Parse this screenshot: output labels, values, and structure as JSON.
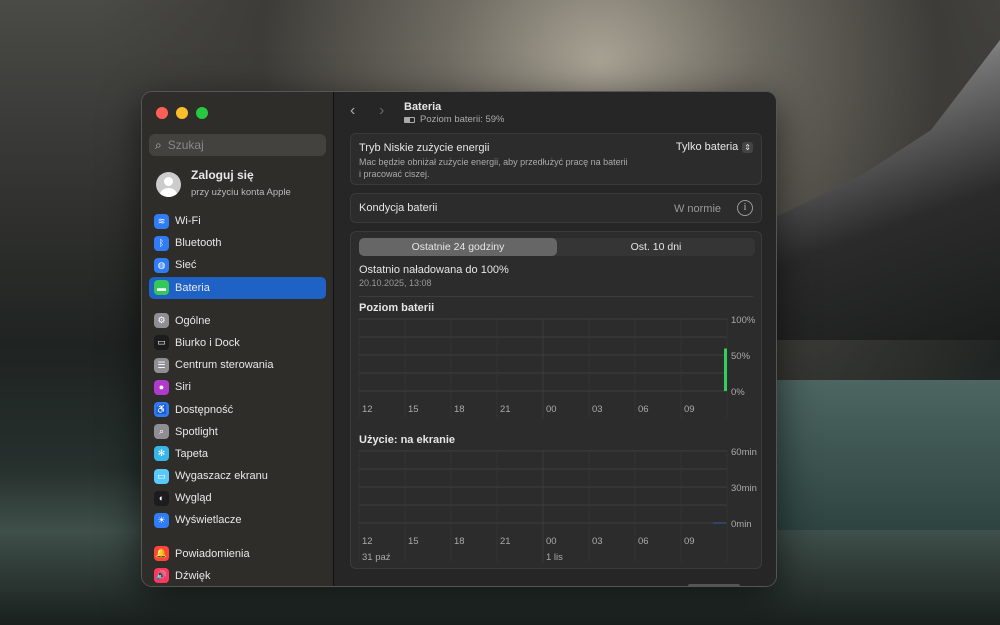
{
  "sidebar": {
    "search_placeholder": "Szukaj",
    "account": {
      "name": "Zaloguj się",
      "sub": "przy użyciu konta Apple"
    },
    "groups": [
      [
        {
          "label": "Wi-Fi",
          "icon": "wifi-icon",
          "color": "#2f7cf6",
          "glyph": "≋"
        },
        {
          "label": "Bluetooth",
          "icon": "bluetooth-icon",
          "color": "#2f7cf6",
          "glyph": "ᛒ"
        },
        {
          "label": "Sieć",
          "icon": "globe-icon",
          "color": "#2f7cf6",
          "glyph": "◍"
        },
        {
          "label": "Bateria",
          "icon": "battery-icon",
          "color": "#34c759",
          "glyph": "▬",
          "selected": true
        }
      ],
      [
        {
          "label": "Ogólne",
          "icon": "gear-icon",
          "color": "#8e8e93",
          "glyph": "⚙"
        },
        {
          "label": "Biurko i Dock",
          "icon": "dock-icon",
          "color": "#1c1c1e",
          "glyph": "▭"
        },
        {
          "label": "Centrum sterowania",
          "icon": "control-center-icon",
          "color": "#8e8e93",
          "glyph": "☰"
        },
        {
          "label": "Siri",
          "icon": "siri-icon",
          "color": "#b03ac9",
          "glyph": "●"
        },
        {
          "label": "Dostępność",
          "icon": "accessibility-icon",
          "color": "#2f7cf6",
          "glyph": "♿"
        },
        {
          "label": "Spotlight",
          "icon": "spotlight-icon",
          "color": "#8e8e93",
          "glyph": "⌕"
        },
        {
          "label": "Tapeta",
          "icon": "wallpaper-icon",
          "color": "#37b7e8",
          "glyph": "✻"
        },
        {
          "label": "Wygaszacz ekranu",
          "icon": "screensaver-icon",
          "color": "#5ac8fa",
          "glyph": "▭"
        },
        {
          "label": "Wygląd",
          "icon": "appearance-icon",
          "color": "#1c1c1e",
          "glyph": "◐"
        },
        {
          "label": "Wyświetlacze",
          "icon": "displays-icon",
          "color": "#2f7cf6",
          "glyph": "☀"
        }
      ],
      [
        {
          "label": "Powiadomienia",
          "icon": "notifications-icon",
          "color": "#ff453a",
          "glyph": "🔔"
        },
        {
          "label": "Dźwięk",
          "icon": "sound-icon",
          "color": "#ff375f",
          "glyph": "🔊"
        }
      ]
    ]
  },
  "header": {
    "title": "Bateria",
    "subtitle": "Poziom baterii: 59%"
  },
  "low_power": {
    "label": "Tryb Niskie zużycie energii",
    "desc1": "Mac będzie obniżał zużycie energii, aby przedłużyć pracę na baterii",
    "desc2": "i pracować ciszej.",
    "value": "Tylko bateria"
  },
  "health": {
    "label": "Kondycja baterii",
    "value": "W normie"
  },
  "tabs": [
    "Ostatnie 24 godziny",
    "Ost. 10 dni"
  ],
  "last_charge": {
    "label": "Ostatnio naładowana do 100%",
    "date": "20.10.2025, 13:08"
  },
  "chart_data": [
    {
      "type": "bar",
      "title": "Poziom baterii",
      "x_ticks": [
        "12",
        "15",
        "18",
        "21",
        "00",
        "03",
        "06",
        "09"
      ],
      "y_ticks": [
        "100%",
        "50%",
        "0%"
      ],
      "ylim": [
        0,
        100
      ],
      "values": [
        {
          "x": "current",
          "y": 59
        }
      ],
      "color": "#30d158"
    },
    {
      "type": "bar",
      "title": "Użycie: na ekranie",
      "x_ticks": [
        "12",
        "15",
        "18",
        "21",
        "00",
        "03",
        "06",
        "09"
      ],
      "date_labels": [
        "31 paź",
        "1 lis"
      ],
      "y_ticks": [
        "60min",
        "30min",
        "0min"
      ],
      "ylim": [
        0,
        60
      ],
      "values": [
        {
          "x": "current",
          "y": 0
        }
      ],
      "color": "#2f7cf6"
    }
  ]
}
